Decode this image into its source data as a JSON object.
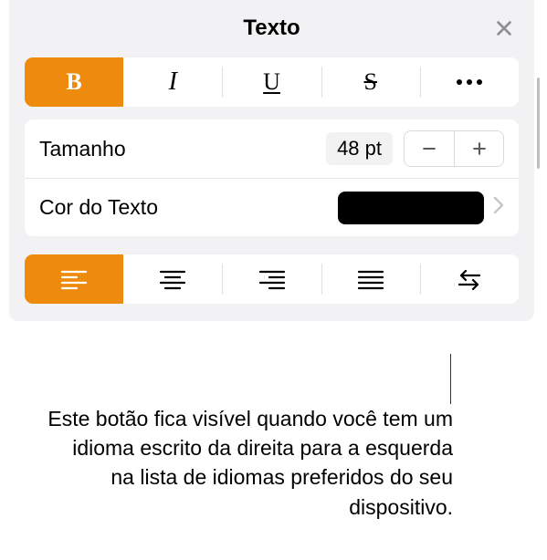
{
  "header": {
    "title": "Texto"
  },
  "style_buttons": {
    "bold": "B",
    "italic": "I",
    "underline": "U",
    "strike": "S"
  },
  "size_row": {
    "label": "Tamanho",
    "value": "48 pt"
  },
  "color_row": {
    "label": "Cor do Texto",
    "swatch": "#000000"
  },
  "callout": "Este botão fica visível quando você tem um idioma escrito da direita para a esquerda na lista de idiomas preferidos do seu dispositivo."
}
